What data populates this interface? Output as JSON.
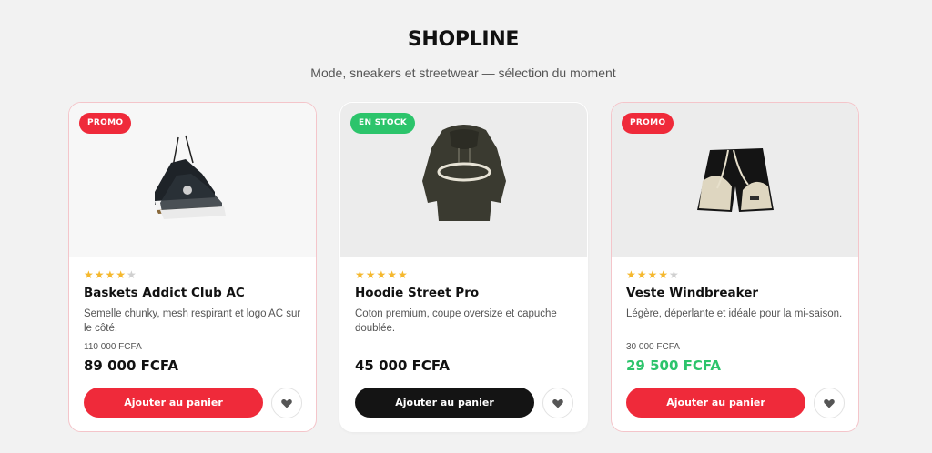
{
  "header": {
    "brand": "SHOPLINE",
    "tagline": "Mode, sneakers et streetwear — sélection du moment"
  },
  "colors": {
    "accent_red": "#ef2a3a",
    "accent_green": "#2cc46b",
    "dark_button": "#141414",
    "star": "#f5b82e",
    "background": "#f2f2f2"
  },
  "products": [
    {
      "badge": "PROMO",
      "badge_color": "red",
      "rating": 4.5,
      "stars_text": "★★★★",
      "stars_off_text": "★",
      "name": "Baskets Addict Club AC",
      "description": "Semelle chunky, mesh respirant et logo AC sur le côté.",
      "old_price": "110 000 FCFA",
      "price": "89 000 FCFA",
      "cart_label": "Ajouter au panier",
      "favorite_icon": "heart-icon"
    },
    {
      "badge": "EN STOCK",
      "badge_color": "green",
      "rating": 5,
      "stars_text": "★★★★★",
      "stars_off_text": "",
      "name": "Hoodie Street Pro",
      "description": "Coton premium, coupe oversize et capuche doublée.",
      "old_price": "",
      "price": "45 000 FCFA",
      "cart_label": "Ajouter au panier",
      "favorite_icon": "heart-icon"
    },
    {
      "badge": "PROMO",
      "badge_color": "red",
      "rating": 4.5,
      "stars_text": "★★★★",
      "stars_off_text": "★",
      "name": "Veste Windbreaker",
      "description": "Légère, déperlante et idéale pour la mi-saison.",
      "old_price": "30 000 FCFA",
      "price": "29 500 FCFA",
      "cart_label": "Ajouter au panier",
      "favorite_icon": "heart-icon"
    }
  ]
}
